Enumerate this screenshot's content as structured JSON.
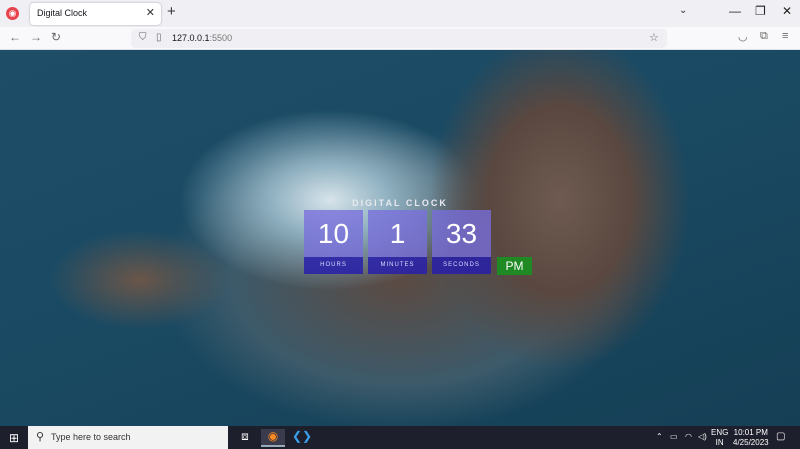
{
  "browser": {
    "tab_title": "Digital Clock",
    "tab_close": "✕",
    "new_tab": "+",
    "list_tabs": "⌄",
    "window_controls": {
      "minimize": "—",
      "restore": "❐",
      "close": "✕"
    },
    "url_host": "127.0.0.1",
    "url_port": ":5500"
  },
  "clock": {
    "title": "DIGITAL CLOCK",
    "hours": "10",
    "minutes": "1",
    "seconds": "33",
    "hours_label": "HOURS",
    "minutes_label": "MINUTES",
    "seconds_label": "SECONDS",
    "period": "PM"
  },
  "taskbar": {
    "search_placeholder": "Type here to search",
    "lang_top": "ENG",
    "lang_bottom": "IN",
    "time": "10:01 PM",
    "date": "4/25/2023"
  },
  "colors": {
    "clock_number_bg": "#786edc",
    "clock_label_bg": "#281eaa",
    "ampm_bg": "#1f8a23"
  }
}
